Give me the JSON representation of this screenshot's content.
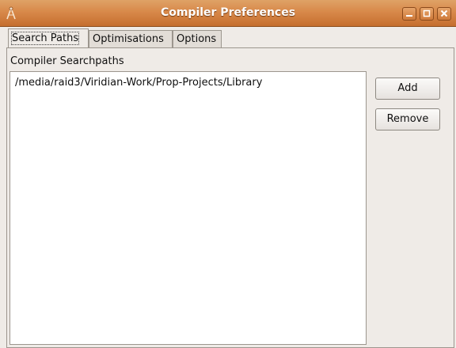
{
  "window": {
    "title": "Compiler Preferences",
    "icon": "compass-icon",
    "controls": [
      "minimize-icon",
      "maximize-icon",
      "close-icon"
    ]
  },
  "tabs": [
    {
      "label": "Search Paths",
      "active": true
    },
    {
      "label": "Optimisations",
      "active": false
    },
    {
      "label": "Options",
      "active": false
    }
  ],
  "search_paths": {
    "section_label": "Compiler Searchpaths",
    "items": [
      "/media/raid3/Viridian-Work/Prop-Projects/Library"
    ],
    "add_label": "Add",
    "remove_label": "Remove"
  },
  "colors": {
    "titlebar": "#d8894a",
    "window_bg": "#efebe7",
    "list_bg": "#ffffff"
  }
}
